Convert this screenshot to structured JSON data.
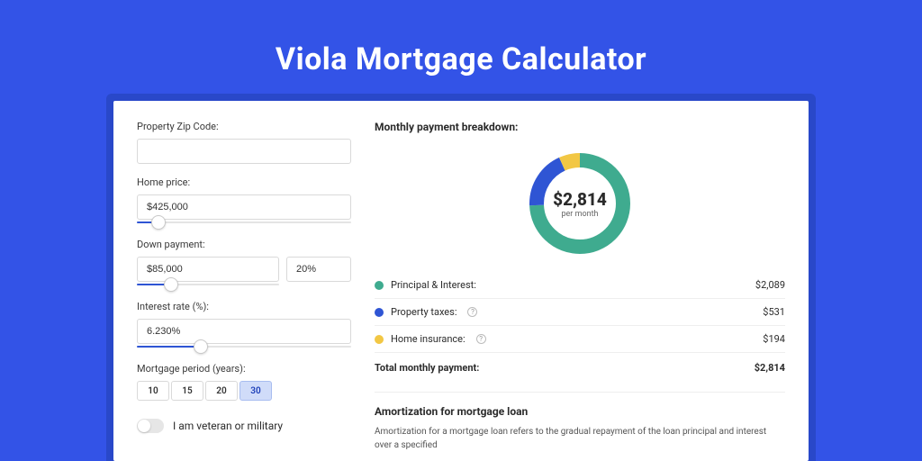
{
  "page_title": "Viola Mortgage Calculator",
  "form": {
    "zip_label": "Property Zip Code:",
    "zip_value": "",
    "home_price_label": "Home price:",
    "home_price_value": "$425,000",
    "home_price_slider_pct": 10,
    "down_payment_label": "Down payment:",
    "down_payment_value": "$85,000",
    "down_payment_pct": "20%",
    "down_payment_slider_pct": 24,
    "interest_label": "Interest rate (%):",
    "interest_value": "6.230%",
    "interest_slider_pct": 30,
    "period_label": "Mortgage period (years):",
    "period_options": [
      "10",
      "15",
      "20",
      "30"
    ],
    "period_active": "30",
    "veteran_label": "I am veteran or military"
  },
  "breakdown": {
    "title": "Monthly payment breakdown:",
    "total_label": "Total monthly payment:",
    "center_amount": "$2,814",
    "center_sub": "per month",
    "items": [
      {
        "label": "Principal & Interest:",
        "value": "$2,089",
        "color": "#3fab8f",
        "has_info": false
      },
      {
        "label": "Property taxes:",
        "value": "$531",
        "color": "#2f55d4",
        "has_info": true
      },
      {
        "label": "Home insurance:",
        "value": "$194",
        "color": "#f2c744",
        "has_info": true
      }
    ],
    "total_value": "$2,814"
  },
  "amortization": {
    "title": "Amortization for mortgage loan",
    "text": "Amortization for a mortgage loan refers to the gradual repayment of the loan principal and interest over a specified"
  },
  "chart_data": {
    "type": "pie",
    "title": "Monthly payment breakdown",
    "series": [
      {
        "name": "Principal & Interest",
        "value": 2089,
        "color": "#3fab8f"
      },
      {
        "name": "Property taxes",
        "value": 531,
        "color": "#2f55d4"
      },
      {
        "name": "Home insurance",
        "value": 194,
        "color": "#f2c744"
      }
    ],
    "total": 2814,
    "center_label": "$2,814 per month"
  }
}
